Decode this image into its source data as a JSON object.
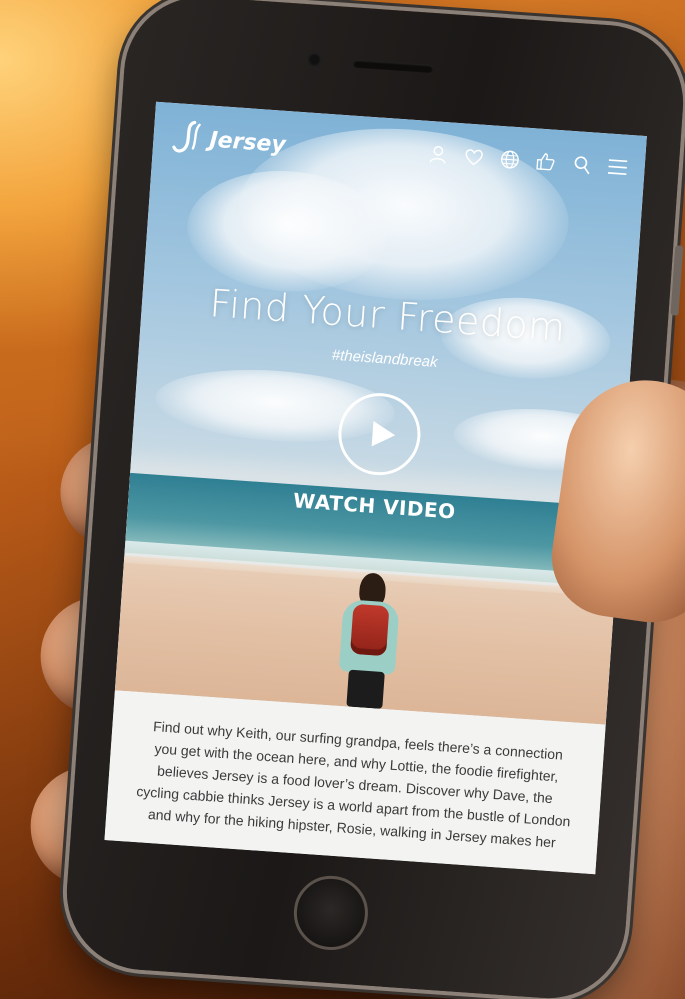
{
  "brand": {
    "name": "Jersey"
  },
  "nav": {
    "icons": [
      {
        "name": "user-icon"
      },
      {
        "name": "heart-icon"
      },
      {
        "name": "globe-icon"
      },
      {
        "name": "thumbs-up-icon"
      },
      {
        "name": "search-icon"
      },
      {
        "name": "menu-icon"
      }
    ]
  },
  "hero": {
    "title": "Find Your Freedom",
    "hashtag": "#theislandbreak",
    "cta_label": "WATCH VIDEO"
  },
  "intro": {
    "text": "Find out why Keith, our surfing grandpa, feels there’s a connection you get with the ocean here, and why Lottie, the foodie firefighter, believes Jersey is a food lover’s dream. Discover why Dave, the cycling cabbie thinks Jersey is a world apart from the bustle of London and why for the hiking hipster, Rosie, walking in Jersey makes her"
  },
  "colors": {
    "background_glow": "#f3a53e",
    "sky": "#a2c6df",
    "sea": "#2f7f93",
    "sand": "#e2bfa3",
    "intro_bg": "#f3f3f1",
    "text": "#3a3a3a"
  }
}
